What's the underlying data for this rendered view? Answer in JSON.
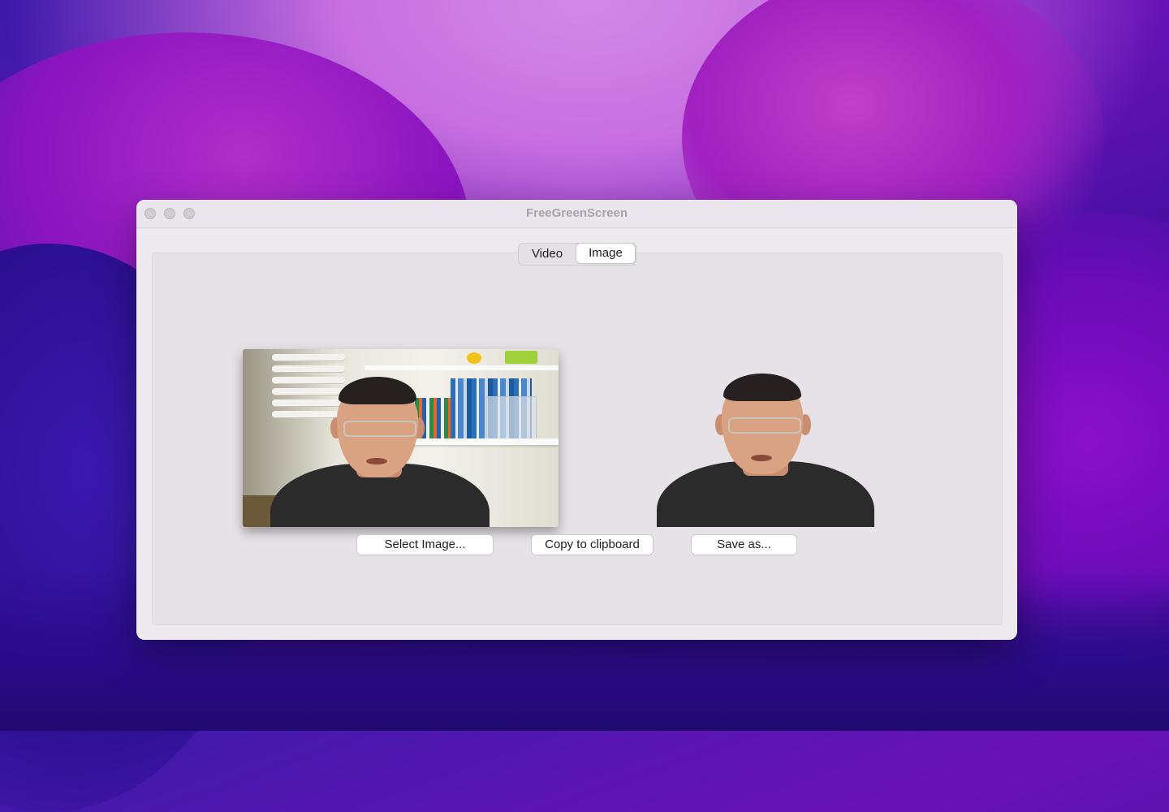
{
  "window": {
    "title": "FreeGreenScreen"
  },
  "tabs": [
    {
      "label": "Video",
      "selected": false
    },
    {
      "label": "Image",
      "selected": true
    }
  ],
  "buttons": {
    "select_image": "Select Image...",
    "copy_clipboard": "Copy to clipboard",
    "save_as": "Save as..."
  },
  "colors": {
    "window_bg": "#ede9ef",
    "panel_bg": "#e6e2e8",
    "wallpaper_accent": "#c76fe0"
  }
}
